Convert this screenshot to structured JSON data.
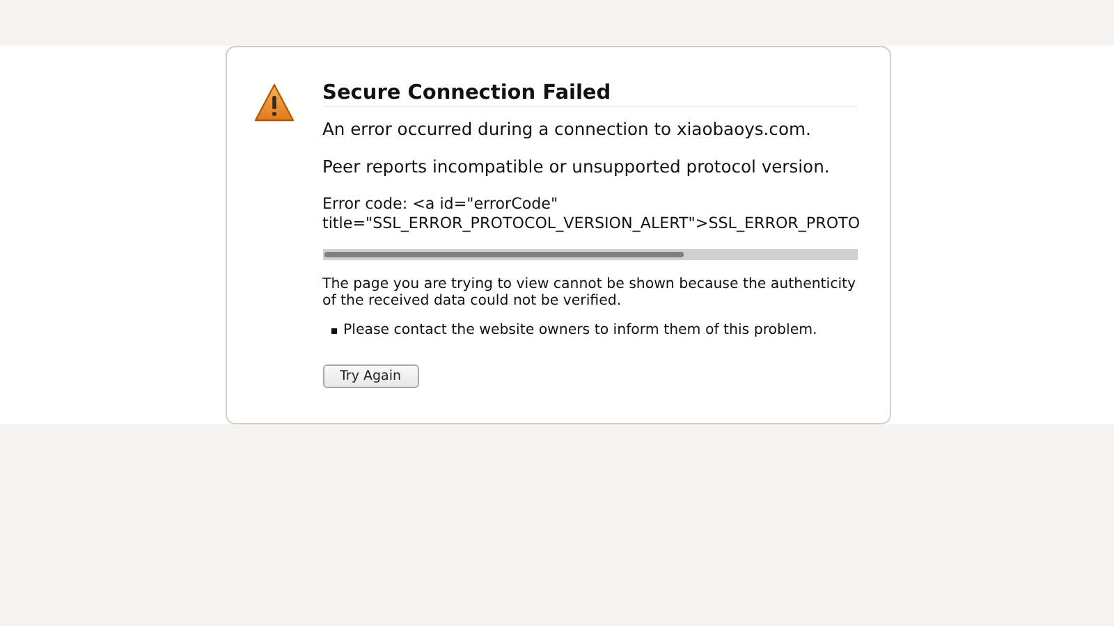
{
  "title": "Secure Connection Failed",
  "messages": [
    "An error occurred during a connection to xiaobaoys.com.",
    "Peer reports incompatible or unsupported protocol version."
  ],
  "error_code": "Error code: <a id=\"errorCode\"\ntitle=\"SSL_ERROR_PROTOCOL_VERSION_ALERT\">SSL_ERROR_PROTO",
  "description": "The page you are trying to view cannot be shown because the authenticity\nof the received data could not be verified.",
  "bullets": [
    "Please contact the website owners to inform them of this problem."
  ],
  "button": "Try Again"
}
